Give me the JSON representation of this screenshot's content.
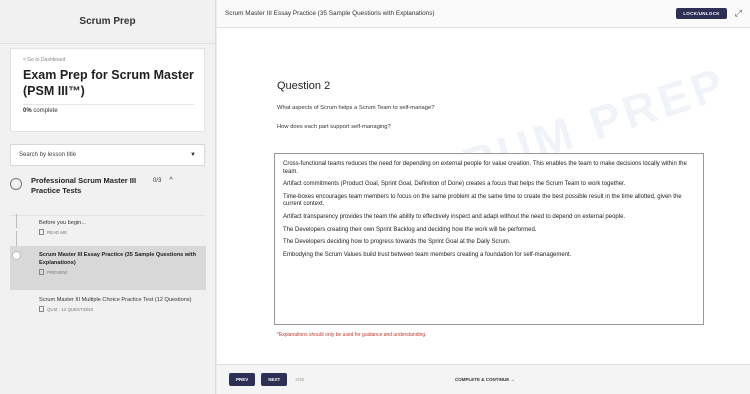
{
  "sidebar": {
    "brand": "Scrum Prep",
    "back_link": "< Go to Dashboard",
    "course_title": "Exam Prep for Scrum Master (PSM III™)",
    "progress_value": "0%",
    "progress_label": "complete",
    "search_placeholder": "Search by lesson title",
    "section": {
      "title": "Professional Scrum Master III Practice Tests",
      "count": "0/3"
    },
    "lessons": [
      {
        "title": "Before you begin...",
        "meta": "READ ME",
        "active": false
      },
      {
        "title": "Scrum Master III Essay Practice (35 Sample Questions with Explanations)",
        "meta": "PREVIEW",
        "active": true
      },
      {
        "title": "Scrum Master III Multiple Choice Practice Test (12 Questions)",
        "meta": "QUIZ · 12 QUESTIONS",
        "active": false
      }
    ]
  },
  "topbar": {
    "title": "Scrum Master III Essay Practice (35 Sample Questions with Explanations)",
    "lock_label": "LOCK/UNLOCK"
  },
  "question": {
    "heading": "Question 2",
    "line1": "What aspects of Scrum helps a Scrum Team to self-manage?",
    "line2": "How does each part support self-managing?",
    "answers": [
      "Cross-functional teams reduces the need for depending on external people for value creation. This enables the team to make decisions locally within the team.",
      "Artifact commitments (Product Goal, Sprint Goal, Definition of Done) creates a focus that helps the Scrum Team to work together.",
      "Time-boxes encourages team members to focus on the same problem at the same time to create the best possible result in the time allotted, given the current context.",
      "Artifact transparency provides the team the ability to effectively inspect and adapt without the need to depend on external people.",
      "The Developers creating their own Sprint Backlog and deciding how the work will be performed.",
      "The Developers deciding how to progress towards the Sprint Goal at the Daily Scrum.",
      "Embodying the Scrum Values build trust between team members creating a foundation for self-management."
    ],
    "note": "*Explanations should only be used for guidance and understanding.",
    "watermark": "SCRUM PREP"
  },
  "bottombar": {
    "prev_label": "PREV",
    "next_label": "NEXT",
    "pager": "2/35",
    "complete_label": "COMPLETE & CONTINUE →"
  },
  "colors": {
    "accent": "#2d2f55",
    "note": "#c0392b",
    "active_lesson_bg": "#d8d8d8"
  }
}
